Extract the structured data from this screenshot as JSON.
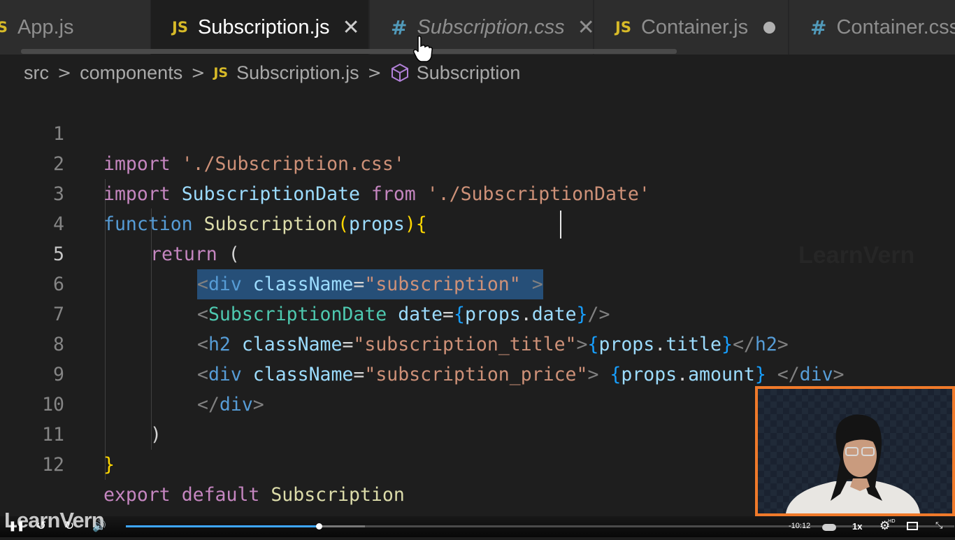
{
  "tabs": [
    {
      "icon": "JS",
      "name": "App.js",
      "indicator": ""
    },
    {
      "icon": "JS",
      "name": "Subscription.js",
      "indicator": "✕"
    },
    {
      "icon": "#",
      "name": "Subscription.css",
      "indicator": "✕"
    },
    {
      "icon": "JS",
      "name": "Container.js",
      "indicator": "●"
    },
    {
      "icon": "#",
      "name": "Container.css",
      "indicator": ""
    }
  ],
  "breadcrumb": {
    "items": [
      "src",
      "components",
      "Subscription.js",
      "Subscription"
    ],
    "separator": ">",
    "file_icon": "JS"
  },
  "editor": {
    "line_numbers": [
      "1",
      "2",
      "3",
      "4",
      "5",
      "6",
      "7",
      "8",
      "9",
      "10",
      "11",
      "12"
    ],
    "lines": [
      [
        "import",
        " './Subscription.css'"
      ],
      [
        "import",
        " SubscriptionDate",
        " from",
        " './SubscriptionDate'"
      ],
      [
        "function",
        " Subscription",
        "(",
        "props",
        "){"
      ],
      [
        "return",
        " ("
      ],
      [
        "<",
        "div",
        " className",
        "=",
        "\"subscription\"",
        " >"
      ],
      [
        "<",
        "SubscriptionDate",
        " date",
        "=",
        "{",
        "props",
        ".",
        "date",
        "}",
        "/>"
      ],
      [
        "<",
        "h2",
        " className",
        "=",
        "\"subscription_title\"",
        ">",
        "{",
        "props",
        ".",
        "title",
        "}",
        "</",
        "h2",
        ">"
      ],
      [
        "<",
        "div",
        " className",
        "=",
        "\"subscription_price\"",
        ">",
        " {",
        "props",
        ".",
        "amount",
        "}",
        " </",
        "div",
        ">"
      ],
      [
        "</",
        "div",
        ">"
      ],
      [
        ")"
      ],
      [
        "}"
      ],
      [
        "export",
        " default",
        " Subscription"
      ]
    ]
  },
  "watermark": "LearnVern",
  "player": {
    "brand": "LearnVern",
    "time_remaining": "-10:12",
    "speed": "1x",
    "progress_fraction": 0.233,
    "quality_badge": "HD"
  },
  "colors": {
    "js_icon": "#d7ba28",
    "css_icon": "#519aba",
    "selection": "#264f78",
    "webcam_border": "#f07a2a",
    "progress": "#3ea6ff"
  }
}
